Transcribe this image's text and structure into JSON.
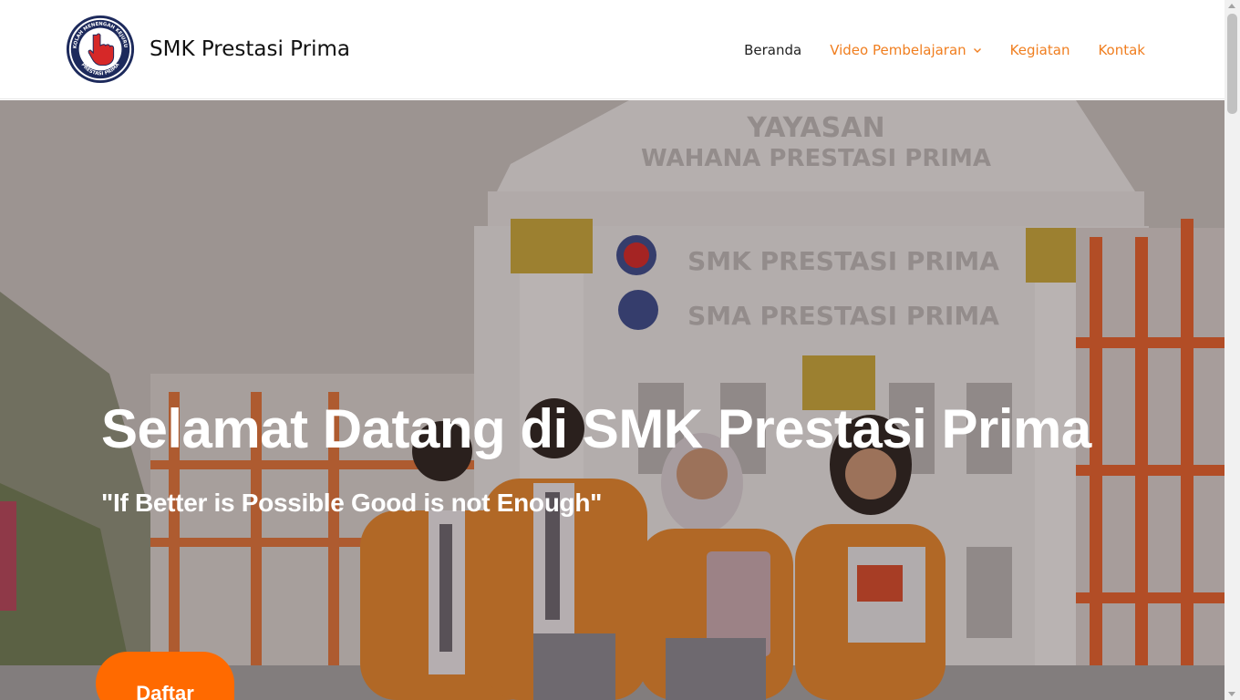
{
  "site": {
    "title": "SMK Prestasi Prima",
    "logo_ring_text": "SEKOLAH MENENGAH KEJURUAN",
    "logo_bottom_text": "PRESTASI PRIMA"
  },
  "nav": {
    "items": [
      {
        "label": "Beranda",
        "active": true
      },
      {
        "label": "Video Pembelajaran",
        "has_dropdown": true
      },
      {
        "label": "Kegiatan"
      },
      {
        "label": "Kontak"
      }
    ]
  },
  "hero": {
    "title": "Selamat Datang di SMK Prestasi Prima",
    "subtitle": "\"If Better is Possible Good is not Enough\"",
    "cta_label": "Daftar",
    "building_sign_top": "YAYASAN",
    "building_sign_bottom": "WAHANA PRESTASI PRIMA",
    "building_sign_smk": "SMK PRESTASI PRIMA",
    "building_sign_sma": "SMA PRESTASI PRIMA"
  },
  "colors": {
    "accent": "#f07e1f",
    "cta": "#ff6a00",
    "logo_navy": "#1d2a5c",
    "logo_red": "#d62828"
  }
}
